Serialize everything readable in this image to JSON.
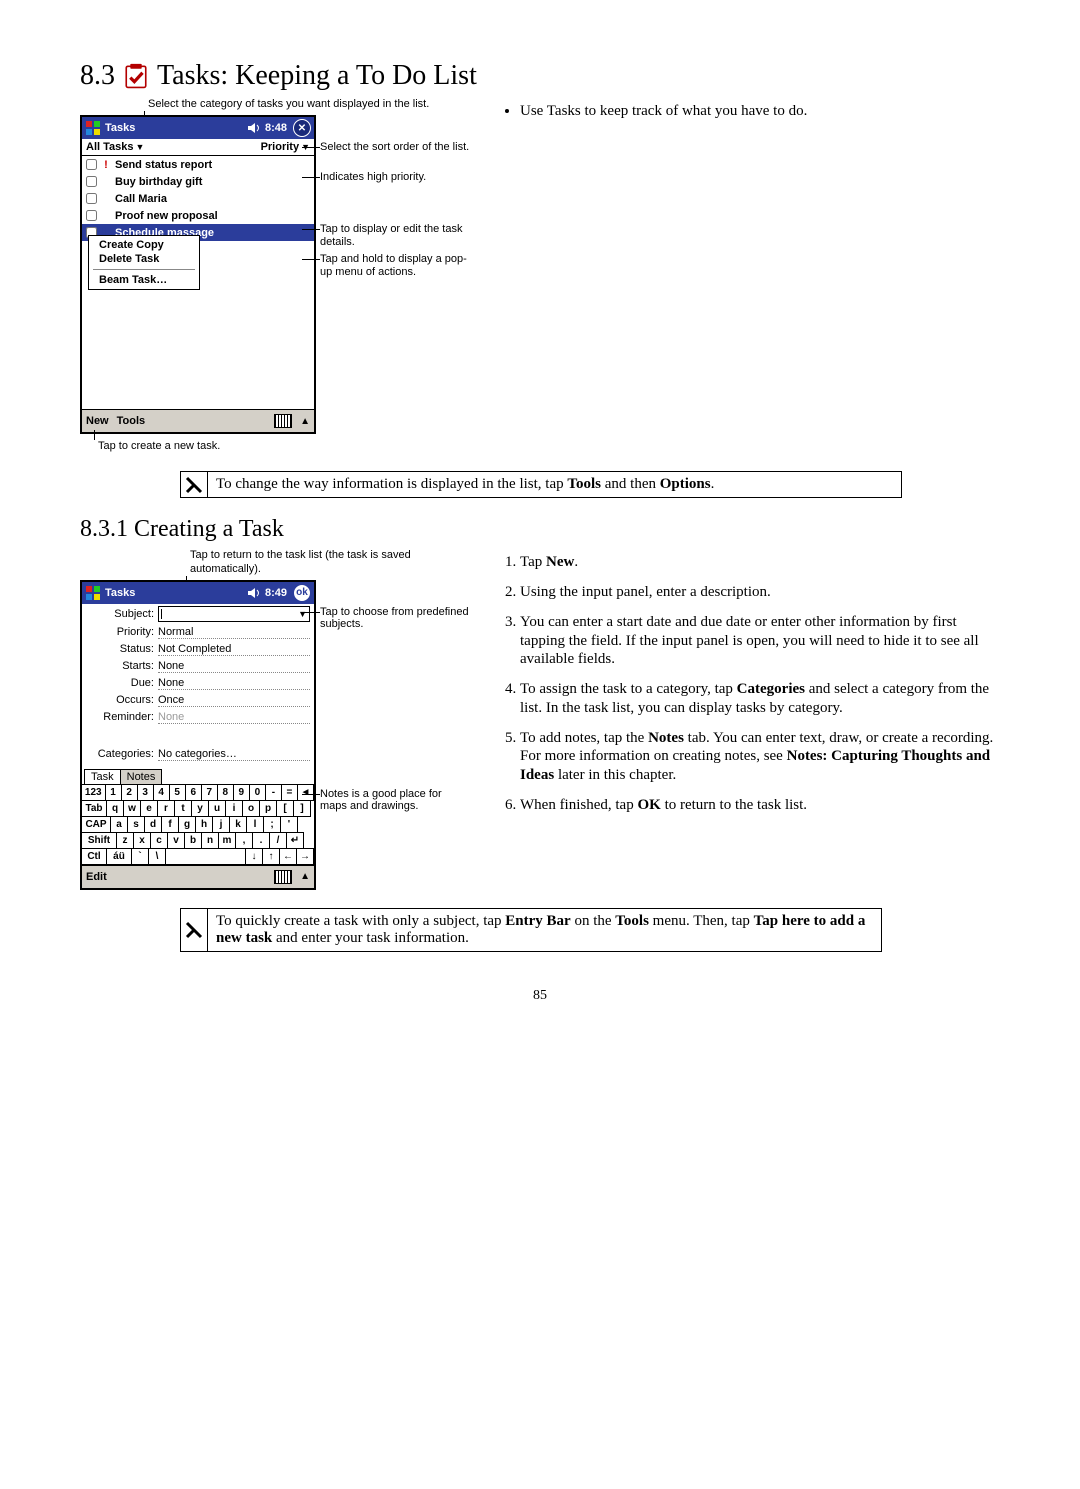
{
  "section": {
    "number": "8.3",
    "title": " Tasks: Keeping a To Do List"
  },
  "subsection": {
    "number": "8.3.1",
    "title": " Creating a Task"
  },
  "intro_bullet": "Use Tasks to keep track of what you have to do.",
  "tip1": "To change the way information is displayed in the list, tap Tools and then Options.",
  "tip2": "To quickly create a task with only a subject, tap Entry Bar on the Tools menu. Then, tap Tap here to add a new task and enter your task information.",
  "page_number": "85",
  "shot1": {
    "caption_top": "Select the category of tasks you want displayed in the list.",
    "caption_bottom": "Tap to create a new task.",
    "title": "Tasks",
    "time": "8:48",
    "header_left": "All Tasks",
    "header_right": "Priority",
    "tasks": [
      {
        "pri": "high",
        "label": "Send status report"
      },
      {
        "pri": "none",
        "label": "Buy birthday gift"
      },
      {
        "pri": "none",
        "label": "Call Maria"
      },
      {
        "pri": "none",
        "label": "Proof new proposal"
      },
      {
        "pri": "low",
        "label": "Schedule massage"
      }
    ],
    "context": {
      "items": [
        "Create Copy",
        "Delete Task",
        "Beam Task…"
      ]
    },
    "menubar": {
      "new": "New",
      "tools": "Tools"
    },
    "callouts": {
      "sort": "Select the sort order of the list.",
      "pri": "Indicates high priority.",
      "edit": "Tap to display or edit the task details.",
      "hold": "Tap and hold to display a pop-up menu of actions."
    }
  },
  "shot2": {
    "caption_top": "Tap to return to the task list (the task is saved automatically).",
    "title": "Tasks",
    "time": "8:49",
    "fields": {
      "subject_label": "Subject:",
      "priority_label": "Priority:",
      "priority_value": "Normal",
      "status_label": "Status:",
      "status_value": "Not Completed",
      "starts_label": "Starts:",
      "starts_value": "None",
      "due_label": "Due:",
      "due_value": "None",
      "occurs_label": "Occurs:",
      "occurs_value": "Once",
      "reminder_label": "Reminder:",
      "reminder_value": "None",
      "categories_label": "Categories:",
      "categories_value": "No categories…"
    },
    "tabs": {
      "task": "Task",
      "notes": "Notes"
    },
    "menubar": {
      "edit": "Edit"
    },
    "keyboard": {
      "row1": [
        "123",
        "1",
        "2",
        "3",
        "4",
        "5",
        "6",
        "7",
        "8",
        "9",
        "0",
        "-",
        "=",
        "◄"
      ],
      "row2": [
        "Tab",
        "q",
        "w",
        "e",
        "r",
        "t",
        "y",
        "u",
        "i",
        "o",
        "p",
        "[",
        "]"
      ],
      "row3": [
        "CAP",
        "a",
        "s",
        "d",
        "f",
        "g",
        "h",
        "j",
        "k",
        "l",
        ";",
        "'"
      ],
      "row4": [
        "Shift",
        "z",
        "x",
        "c",
        "v",
        "b",
        "n",
        "m",
        ",",
        ".",
        "/",
        "↵"
      ],
      "row5": [
        "Ctl",
        "áü",
        "`",
        "\\",
        " ",
        "↓",
        "↑",
        "←",
        "→"
      ]
    },
    "callouts": {
      "subject": "Tap to choose from predefined subjects.",
      "notes": "Notes is a good place for maps and drawings."
    }
  },
  "steps": {
    "1": "Tap New.",
    "2": "Using the input panel, enter a description.",
    "3": "You can enter a start date and due date or enter other information by first tapping the field. If the input panel is open, you will need to hide it to see all available fields.",
    "4": "To assign the task to a category, tap Categories and select a category from the list. In the task list, you can display tasks by category.",
    "5": "To add notes, tap the Notes tab. You can enter text, draw, or create a recording. For more information on creating notes, see Notes: Capturing Thoughts and Ideas later in this chapter.",
    "6": "When finished, tap OK to return to the task list."
  }
}
